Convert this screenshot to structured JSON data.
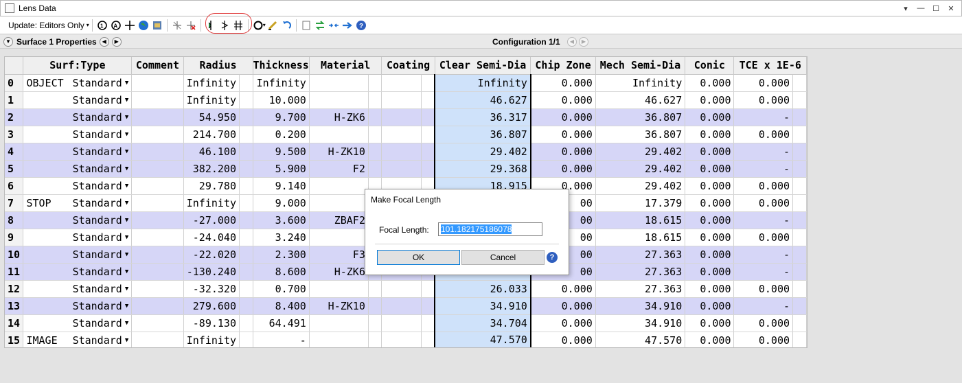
{
  "window": {
    "title": "Lens Data",
    "controls": [
      "▾",
      "—",
      "☐",
      "✕"
    ]
  },
  "toolbar": {
    "update_label": "Update: Editors Only",
    "icons": [
      "refresh-icon",
      "refresh-all-icon",
      "crosshair-icon",
      "globe-icon",
      "map-icon",
      "make-focal-icon",
      "remove-focal-icon",
      "focal-length-icon",
      "thickness-icon",
      "radius-icon",
      "circle-icon",
      "solve-icon",
      "undo-icon",
      "page-icon",
      "swap-icon",
      "collapse-icon",
      "arrow-right-icon",
      "help-icon"
    ]
  },
  "propbar": {
    "label": "Surface 1 Properties",
    "config": "Configuration 1/1"
  },
  "table": {
    "headers": [
      "Surf:Type",
      "Comment",
      "Radius",
      "Thickness",
      "Material",
      "Coating",
      "Clear Semi-Dia",
      "Chip Zone",
      "Mech Semi-Dia",
      "Conic",
      "TCE x 1E-6"
    ],
    "rows": [
      {
        "idx": "0",
        "comment": "OBJECT",
        "type": "Standard",
        "radius": "Infinity",
        "thickness": "Infinity",
        "material": "",
        "coating": "",
        "clear": "Infinity",
        "chip": "0.000",
        "mech": "Infinity",
        "conic": "0.000",
        "tce": "0.000"
      },
      {
        "idx": "1",
        "comment": "",
        "type": "Standard",
        "radius": "Infinity",
        "thickness": "10.000",
        "material": "",
        "coating": "",
        "clear": "46.627",
        "chip": "0.000",
        "mech": "46.627",
        "conic": "0.000",
        "tce": "0.000"
      },
      {
        "idx": "2",
        "comment": "",
        "type": "Standard",
        "radius": "54.950",
        "thickness": "9.700",
        "material": "H-ZK6",
        "coating": "",
        "clear": "36.317",
        "chip": "0.000",
        "mech": "36.807",
        "conic": "0.000",
        "tce": "-"
      },
      {
        "idx": "3",
        "comment": "",
        "type": "Standard",
        "radius": "214.700",
        "thickness": "0.200",
        "material": "",
        "coating": "",
        "clear": "36.807",
        "chip": "0.000",
        "mech": "36.807",
        "conic": "0.000",
        "tce": "0.000"
      },
      {
        "idx": "4",
        "comment": "",
        "type": "Standard",
        "radius": "46.100",
        "thickness": "9.500",
        "material": "H-ZK10",
        "coating": "",
        "clear": "29.402",
        "chip": "0.000",
        "mech": "29.402",
        "conic": "0.000",
        "tce": "-"
      },
      {
        "idx": "5",
        "comment": "",
        "type": "Standard",
        "radius": "382.200",
        "thickness": "5.900",
        "material": "F2",
        "coating": "",
        "clear": "29.368",
        "chip": "0.000",
        "mech": "29.402",
        "conic": "0.000",
        "tce": "-"
      },
      {
        "idx": "6",
        "comment": "",
        "type": "Standard",
        "radius": "29.780",
        "thickness": "9.140",
        "material": "",
        "coating": "",
        "clear": "18.915",
        "chip": "0.000",
        "mech": "29.402",
        "conic": "0.000",
        "tce": "0.000"
      },
      {
        "idx": "7",
        "comment": "STOP",
        "type": "Standard",
        "radius": "Infinity",
        "thickness": "9.000",
        "material": "",
        "coating": "",
        "clear": "",
        "chip": "00",
        "mech": "17.379",
        "conic": "0.000",
        "tce": "0.000"
      },
      {
        "idx": "8",
        "comment": "",
        "type": "Standard",
        "radius": "-27.000",
        "thickness": "3.600",
        "material": "ZBAF2",
        "coating": "",
        "clear": "",
        "chip": "00",
        "mech": "18.615",
        "conic": "0.000",
        "tce": "-"
      },
      {
        "idx": "9",
        "comment": "",
        "type": "Standard",
        "radius": "-24.040",
        "thickness": "3.240",
        "material": "",
        "coating": "",
        "clear": "",
        "chip": "00",
        "mech": "18.615",
        "conic": "0.000",
        "tce": "0.000"
      },
      {
        "idx": "10",
        "comment": "",
        "type": "Standard",
        "radius": "-22.020",
        "thickness": "2.300",
        "material": "F3",
        "coating": "",
        "clear": "",
        "chip": "00",
        "mech": "27.363",
        "conic": "0.000",
        "tce": "-"
      },
      {
        "idx": "11",
        "comment": "",
        "type": "Standard",
        "radius": "-130.240",
        "thickness": "8.600",
        "material": "H-ZK6",
        "coating": "",
        "clear": "",
        "chip": "00",
        "mech": "27.363",
        "conic": "0.000",
        "tce": "-"
      },
      {
        "idx": "12",
        "comment": "",
        "type": "Standard",
        "radius": "-32.320",
        "thickness": "0.700",
        "material": "",
        "coating": "",
        "clear": "26.033",
        "chip": "0.000",
        "mech": "27.363",
        "conic": "0.000",
        "tce": "0.000"
      },
      {
        "idx": "13",
        "comment": "",
        "type": "Standard",
        "radius": "279.600",
        "thickness": "8.400",
        "material": "H-ZK10",
        "coating": "",
        "clear": "34.910",
        "chip": "0.000",
        "mech": "34.910",
        "conic": "0.000",
        "tce": "-"
      },
      {
        "idx": "14",
        "comment": "",
        "type": "Standard",
        "radius": "-89.130",
        "thickness": "64.491",
        "material": "",
        "coating": "",
        "clear": "34.704",
        "chip": "0.000",
        "mech": "34.910",
        "conic": "0.000",
        "tce": "0.000"
      },
      {
        "idx": "15",
        "comment": "IMAGE",
        "type": "Standard",
        "radius": "Infinity",
        "thickness": "-",
        "material": "",
        "coating": "",
        "clear": "47.570",
        "chip": "0.000",
        "mech": "47.570",
        "conic": "0.000",
        "tce": "0.000"
      }
    ]
  },
  "dialog": {
    "title": "Make Focal Length",
    "label": "Focal Length:",
    "value": "101.182175186078",
    "ok": "OK",
    "cancel": "Cancel",
    "help": "?"
  }
}
